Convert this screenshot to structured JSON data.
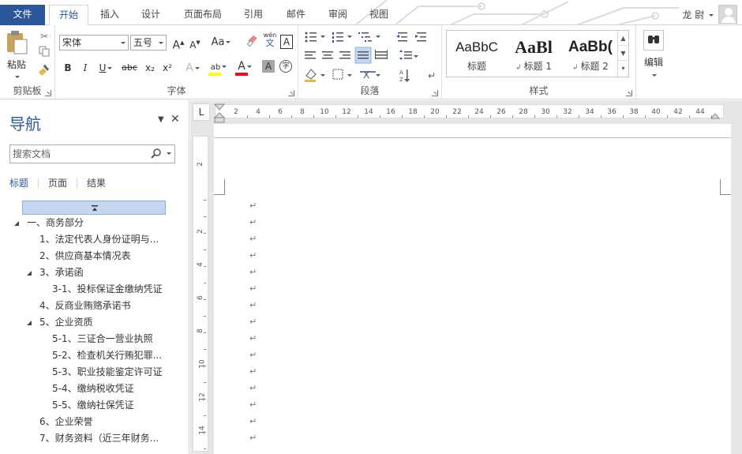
{
  "tabs": {
    "file": "文件",
    "items": [
      "开始",
      "插入",
      "设计",
      "页面布局",
      "引用",
      "邮件",
      "审阅",
      "视图"
    ],
    "active": "开始"
  },
  "user": {
    "name": "龙 尉"
  },
  "ribbon": {
    "clipboard": {
      "label": "剪贴板",
      "paste": "粘贴"
    },
    "font": {
      "label": "字体",
      "font_name": "宋体",
      "font_size": "五号",
      "grow": "A",
      "shrink": "A",
      "case": "Aa",
      "pinyin": "wén",
      "pinyin_char": "文",
      "border_char": "A",
      "bold": "B",
      "italic": "I",
      "underline": "U",
      "strike": "abc",
      "subscript": "x₂",
      "superscript": "x²",
      "effects": "A",
      "highlight": "ab",
      "font_color": "A",
      "shade": "A",
      "enclose": "字"
    },
    "paragraph": {
      "label": "段落"
    },
    "styles": {
      "label": "样式",
      "items": [
        {
          "sample": "AaBbC",
          "name": "标题"
        },
        {
          "sample": "AaBl",
          "name": "标题 1"
        },
        {
          "sample": "AaBb(",
          "name": "标题 2"
        }
      ]
    },
    "editing": {
      "label": "编辑"
    }
  },
  "navigation": {
    "title": "导航",
    "search_placeholder": "搜索文档",
    "tabs": [
      "标题",
      "页面",
      "结果"
    ],
    "items": [
      {
        "text": "一、商务部分",
        "level": 1,
        "expandable": true
      },
      {
        "text": "1、法定代表人身份证明与...",
        "level": 2,
        "expandable": false
      },
      {
        "text": "2、供应商基本情况表",
        "level": 2,
        "expandable": false
      },
      {
        "text": "3、承诺函",
        "level": 2,
        "expandable": true
      },
      {
        "text": "3-1、投标保证金缴纳凭证",
        "level": 3,
        "expandable": false
      },
      {
        "text": "4、反商业贿赂承诺书",
        "level": 2,
        "expandable": false
      },
      {
        "text": "5、企业资质",
        "level": 2,
        "expandable": true
      },
      {
        "text": "5-1、三证合一营业执照",
        "level": 3,
        "expandable": false
      },
      {
        "text": "5-2、检查机关行贿犯罪...",
        "level": 3,
        "expandable": false
      },
      {
        "text": "5-3、职业技能鉴定许可证",
        "level": 3,
        "expandable": false
      },
      {
        "text": "5-4、缴纳税收凭证",
        "level": 3,
        "expandable": false
      },
      {
        "text": "5-5、缴纳社保凭证",
        "level": 3,
        "expandable": false
      },
      {
        "text": "6、企业荣誉",
        "level": 2,
        "expandable": false
      },
      {
        "text": "7、财务资料（近三年财务...",
        "level": 2,
        "expandable": false
      }
    ]
  },
  "ruler": {
    "corner": "L",
    "horizontal_ticks": [
      "2",
      "4",
      "6",
      "8",
      "10",
      "12",
      "14",
      "16",
      "18",
      "20",
      "22",
      "24",
      "26",
      "28",
      "30",
      "32",
      "34",
      "36",
      "38",
      "40",
      "42",
      "44"
    ],
    "vertical_ticks": [
      "2",
      "2",
      "4",
      "6",
      "8",
      "10",
      "12",
      "14"
    ]
  },
  "document": {
    "paragraph_mark": "↵",
    "paragraph_count": 15
  },
  "colors": {
    "accent": "#2b579a",
    "nav_selected": "#c5d6f0"
  }
}
